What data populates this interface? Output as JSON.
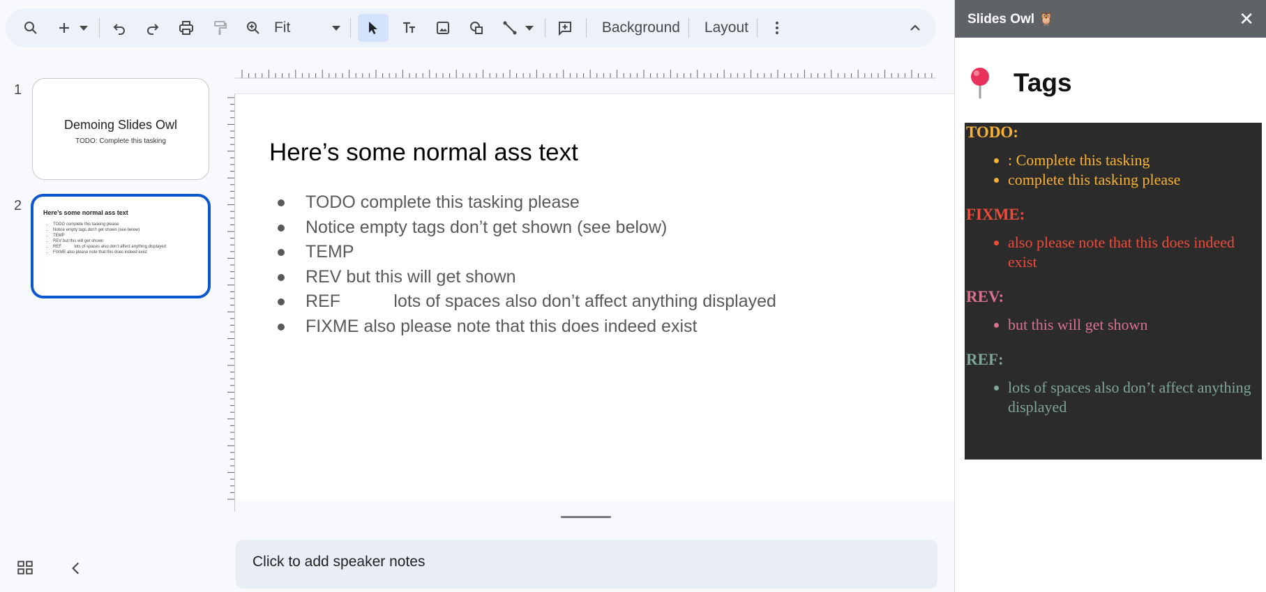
{
  "toolbar": {
    "zoom_value": "Fit",
    "background_label": "Background",
    "layout_label": "Layout",
    "icons": [
      "search-icon",
      "add-icon",
      "undo-icon",
      "redo-icon",
      "print-icon",
      "paint-format-icon",
      "zoom-icon",
      "select-cursor-icon",
      "text-box-icon",
      "image-icon",
      "shapes-icon",
      "line-icon",
      "add-comment-icon",
      "more-vert-icon",
      "collapse-icon"
    ]
  },
  "filmstrip": {
    "slides": [
      {
        "number": "1",
        "title": "Demoing Slides Owl",
        "subtitle": "TODO: Complete this tasking"
      },
      {
        "number": "2",
        "title": "Here’s some normal ass text",
        "bullets": [
          "TODO complete this tasking please",
          "Notice empty tags don’t get shown (see below)",
          "TEMP",
          "REV but this will get shown",
          "REF           lots of spaces also don’t affect anything displayed",
          "FIXME also please note that this does indeed exist"
        ]
      }
    ],
    "selected_slide": "2"
  },
  "slide": {
    "title": "Here’s some normal ass text",
    "bullets": [
      "TODO complete this tasking please",
      "Notice empty tags don’t get shown (see below)",
      "TEMP",
      "REV but this will get shown",
      "REF           lots of spaces also don’t affect anything displayed",
      "FIXME also please note that this does indeed exist"
    ]
  },
  "notes": {
    "placeholder": "Click to add speaker notes"
  },
  "panel": {
    "title": "Slides Owl 🦉",
    "close": "✕",
    "heading": "Tags",
    "groups": [
      {
        "label": "TODO:",
        "color": "#f9b233",
        "items": [
          ": Complete this tasking",
          "complete this tasking please"
        ]
      },
      {
        "label": "FIXME:",
        "color": "#ee4b3a",
        "items": [
          "also please note that this does indeed exist"
        ]
      },
      {
        "label": "REV:",
        "color": "#d9728f",
        "items": [
          "but this will get shown"
        ]
      },
      {
        "label": "REF:",
        "color": "#7fa696",
        "items": [
          "lots of spaces also don’t affect anything displayed"
        ]
      }
    ]
  }
}
